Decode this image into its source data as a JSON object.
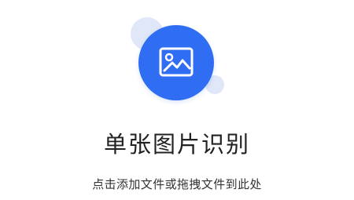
{
  "upload": {
    "title": "单张图片识别",
    "hint": "点击添加文件或拖拽文件到此处",
    "icon": "image-icon"
  },
  "colors": {
    "accent": "#2f6df3",
    "bubble": "#dfe7f8",
    "title_text": "#222222",
    "hint_text": "#333333"
  }
}
